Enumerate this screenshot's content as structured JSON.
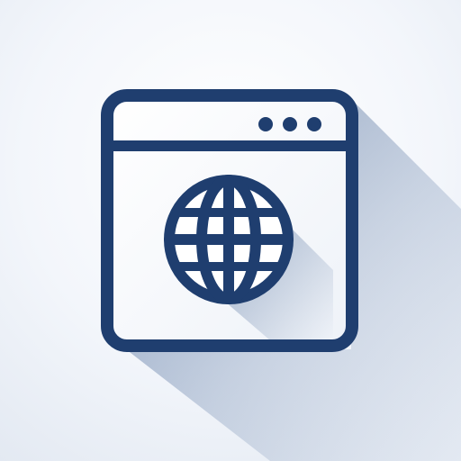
{
  "icon": {
    "name": "web-browser-globe-icon",
    "colors": {
      "primary": "#1f3e6f",
      "background": "#f3f6fb",
      "window_fill": "#ffffff",
      "shadow": "#2a4f86"
    },
    "window_dots": 3
  }
}
